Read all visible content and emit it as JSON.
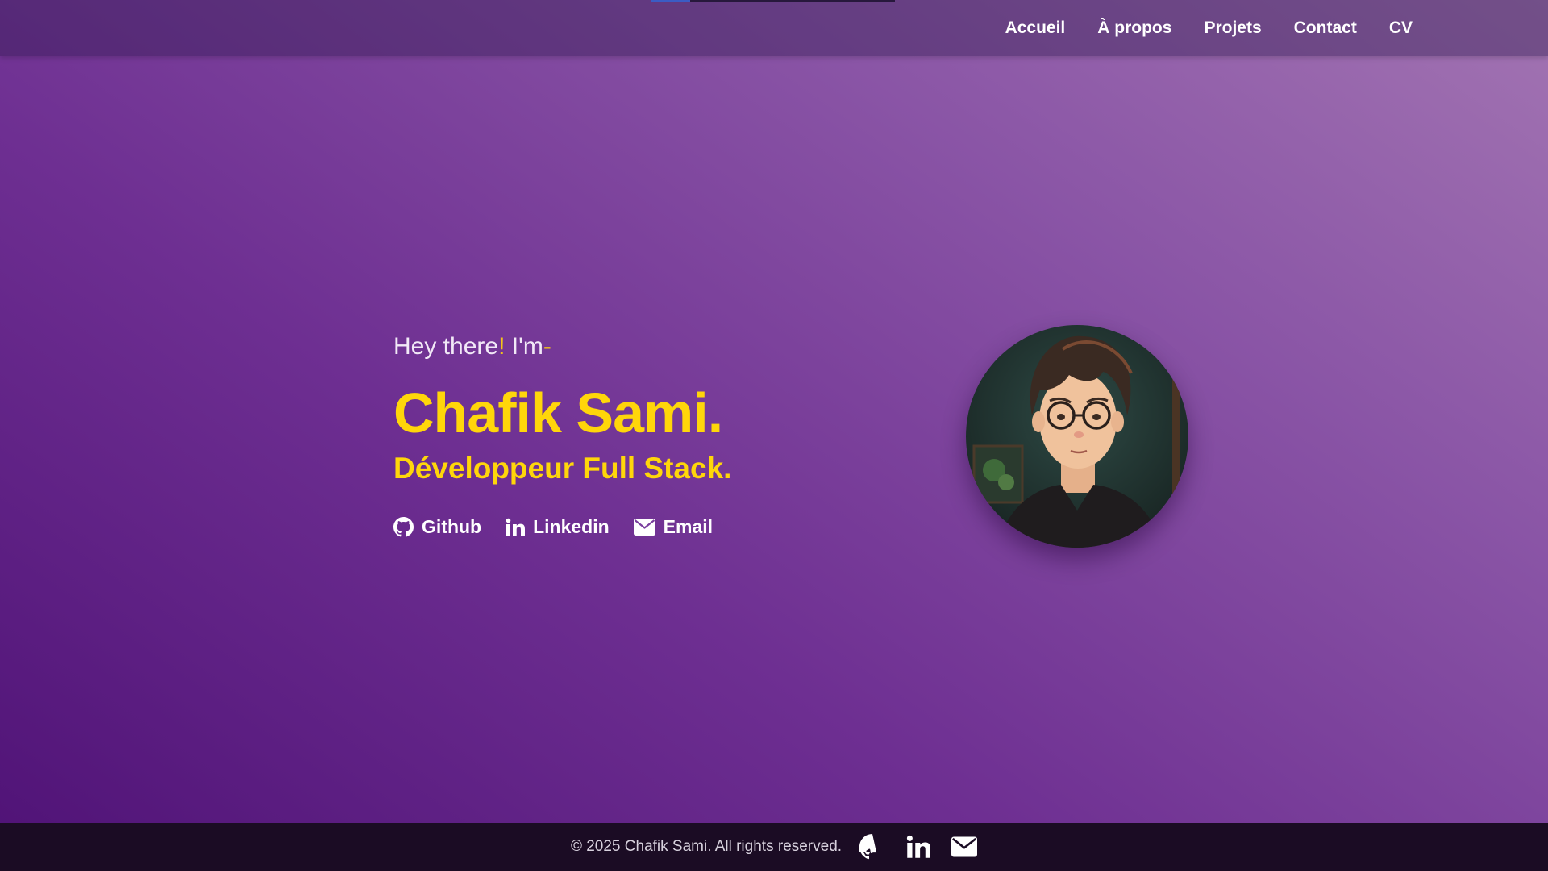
{
  "nav": {
    "items": [
      {
        "label": "Accueil"
      },
      {
        "label": "À propos"
      },
      {
        "label": "Projets"
      },
      {
        "label": "Contact"
      },
      {
        "label": "CV"
      }
    ],
    "scroll_progress_fraction": 0.16
  },
  "hero": {
    "greeting_prefix": "Hey there",
    "greeting_exclaim": "!",
    "greeting_middle": " I'm",
    "greeting_dash": "-",
    "name": "Chafik Sami.",
    "role": "Développeur Full Stack.",
    "socials": [
      {
        "label": "Github",
        "icon": "github-icon"
      },
      {
        "label": "Linkedin",
        "icon": "linkedin-icon"
      },
      {
        "label": "Email",
        "icon": "envelope-icon"
      }
    ]
  },
  "footer": {
    "copyright": "© 2025 Chafik Sami. All rights reserved.",
    "icons": [
      "github-icon",
      "linkedin-icon",
      "envelope-icon"
    ]
  },
  "colors": {
    "accent_yellow": "#ffd60a",
    "footer_bg": "#1b0c24",
    "gradient_start": "#4f1276",
    "gradient_end": "#a274b2"
  }
}
